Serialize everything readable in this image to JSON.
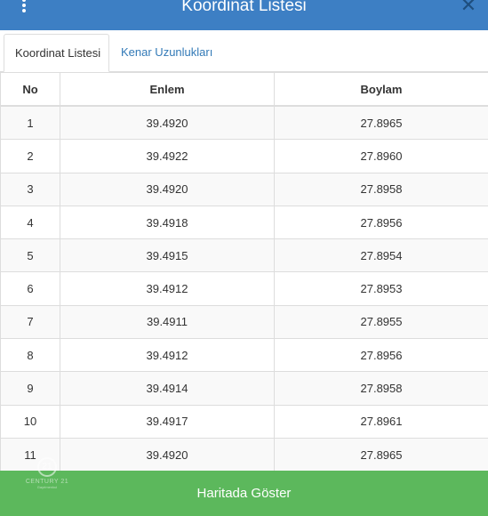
{
  "header": {
    "title": "Koordinat Listesi",
    "close_symbol": "✕",
    "menu_icon": "vertical-dots-icon",
    "accent_color": "#3d7fc4"
  },
  "tabs": [
    {
      "label": "Koordinat Listesi",
      "active": true
    },
    {
      "label": "Kenar Uzunlukları",
      "active": false
    }
  ],
  "table": {
    "columns": [
      "No",
      "Enlem",
      "Boylam"
    ],
    "rows": [
      {
        "no": "1",
        "enlem": "39.4920",
        "boylam": "27.8965"
      },
      {
        "no": "2",
        "enlem": "39.4922",
        "boylam": "27.8960"
      },
      {
        "no": "3",
        "enlem": "39.4920",
        "boylam": "27.8958"
      },
      {
        "no": "4",
        "enlem": "39.4918",
        "boylam": "27.8956"
      },
      {
        "no": "5",
        "enlem": "39.4915",
        "boylam": "27.8954"
      },
      {
        "no": "6",
        "enlem": "39.4912",
        "boylam": "27.8953"
      },
      {
        "no": "7",
        "enlem": "39.4911",
        "boylam": "27.8955"
      },
      {
        "no": "8",
        "enlem": "39.4912",
        "boylam": "27.8956"
      },
      {
        "no": "9",
        "enlem": "39.4914",
        "boylam": "27.8958"
      },
      {
        "no": "10",
        "enlem": "39.4917",
        "boylam": "27.8961"
      },
      {
        "no": "11",
        "enlem": "39.4920",
        "boylam": "27.8965"
      }
    ]
  },
  "footer": {
    "button_label": "Haritada Göster",
    "button_color": "#5cb85c"
  },
  "logo": {
    "mark": "21",
    "name": "CENTURY 21",
    "sub": "Gayrimenkul"
  }
}
